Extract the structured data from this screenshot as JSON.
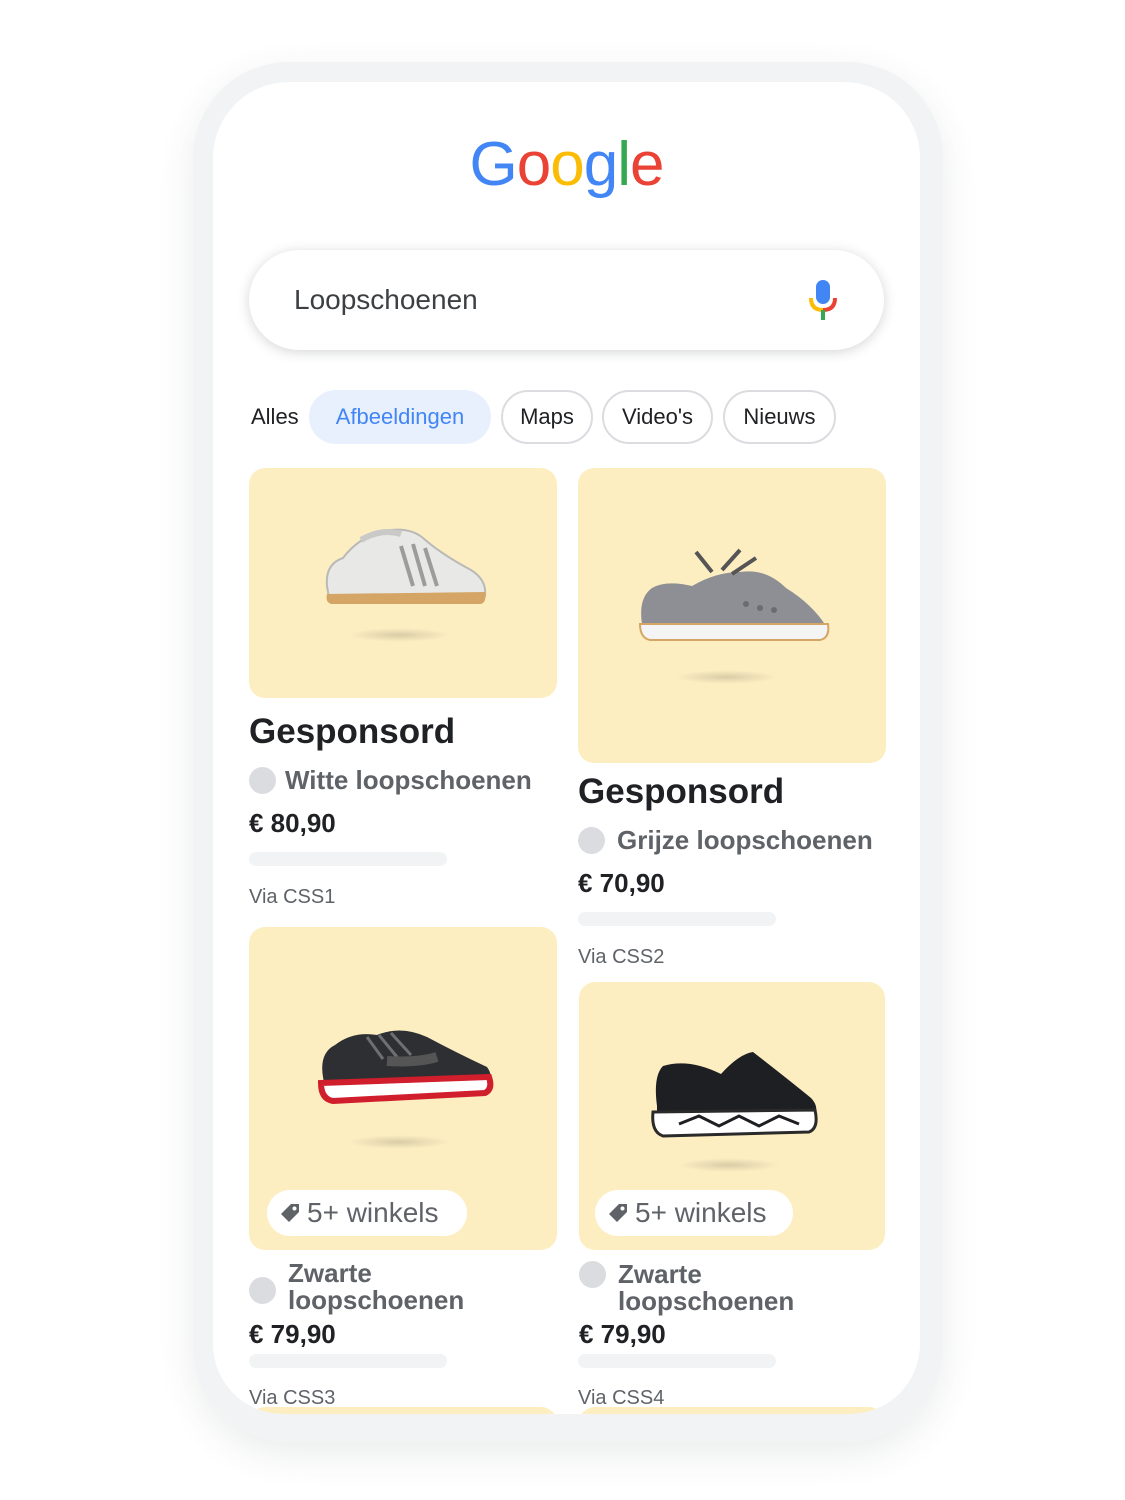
{
  "logo": {
    "letters": [
      {
        "char": "G",
        "color": "#4285F4"
      },
      {
        "char": "o",
        "color": "#EA4335"
      },
      {
        "char": "o",
        "color": "#FBBC05"
      },
      {
        "char": "g",
        "color": "#4285F4"
      },
      {
        "char": "l",
        "color": "#34A853"
      },
      {
        "char": "e",
        "color": "#EA4335"
      }
    ]
  },
  "search": {
    "query": "Loopschoenen",
    "mic_icon": "microphone-icon"
  },
  "tabs": [
    {
      "label": "Alles",
      "active": false
    },
    {
      "label": "Afbeeldingen",
      "active": true
    },
    {
      "label": "Maps",
      "active": false
    },
    {
      "label": "Video's",
      "active": false
    },
    {
      "label": "Nieuws",
      "active": false
    }
  ],
  "products": [
    {
      "sponsored": "Gesponsord",
      "title": "Witte loopschoenen",
      "price": "€ 80,90",
      "via": "Via CSS1",
      "badge": ""
    },
    {
      "sponsored": "Gesponsord",
      "title": "Grijze loopschoenen",
      "price": "€ 70,90",
      "via": "Via CSS2",
      "badge": ""
    },
    {
      "sponsored": "",
      "title": "Zwarte loopschoenen",
      "price": "€ 79,90",
      "via": "Via CSS3",
      "badge": "5+ winkels"
    },
    {
      "sponsored": "",
      "title": "Zwarte loopschoenen",
      "price": "€ 79,90",
      "via": "Via CSS4",
      "badge": "5+ winkels"
    }
  ],
  "colors": {
    "card_background": "#FDEEC2",
    "active_tab_background": "#E8F0FE",
    "active_tab_text": "#4285F4"
  }
}
